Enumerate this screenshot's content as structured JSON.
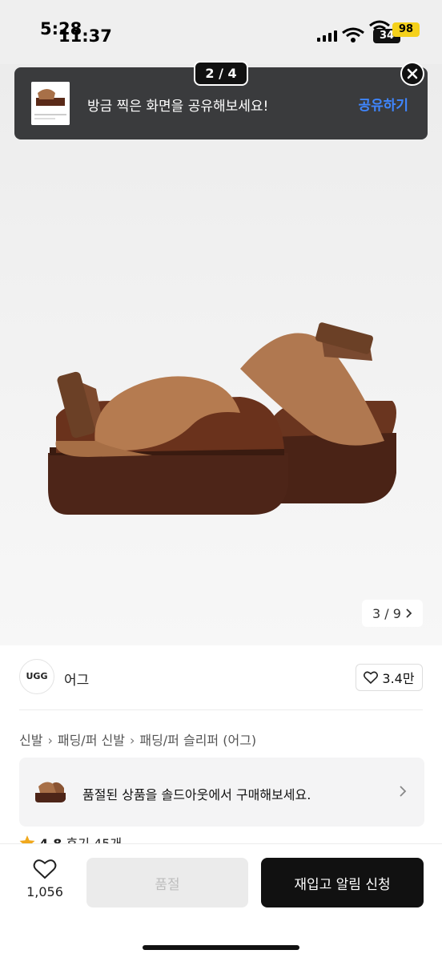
{
  "status_bar": {
    "time_primary": "5:28",
    "time_overlay": "11:37",
    "battery_primary": "34",
    "battery_overlay": "98"
  },
  "share_banner": {
    "message": "방금 찍은 화면을 공유해보세요!",
    "action_label": "공유하기",
    "screenshot_counter": "2 / 4"
  },
  "gallery": {
    "pager": "3 / 9"
  },
  "brand": {
    "logo_text": "UGG",
    "name": "어그",
    "likes": "3.4만"
  },
  "breadcrumb": [
    "신발",
    "패딩/퍼 신발",
    "패딩/퍼 슬리퍼 (어그)"
  ],
  "soldout_notice": {
    "text": "품절된 상품을 솔드아웃에서 구매해보세요."
  },
  "rating": {
    "score": "4.8",
    "reviews": "후기 45개"
  },
  "bottom_bar": {
    "wishlist_count": "1,056",
    "soldout_button": "품절",
    "restock_button": "재입고 알림 신청"
  },
  "colors": {
    "accent_link": "#3f86ff",
    "banner_bg": "#3a3b3d",
    "primary_button": "#111111",
    "disabled_button": "#ebebeb",
    "battery_overlay": "#f5d11b",
    "star": "#f0a81c"
  }
}
